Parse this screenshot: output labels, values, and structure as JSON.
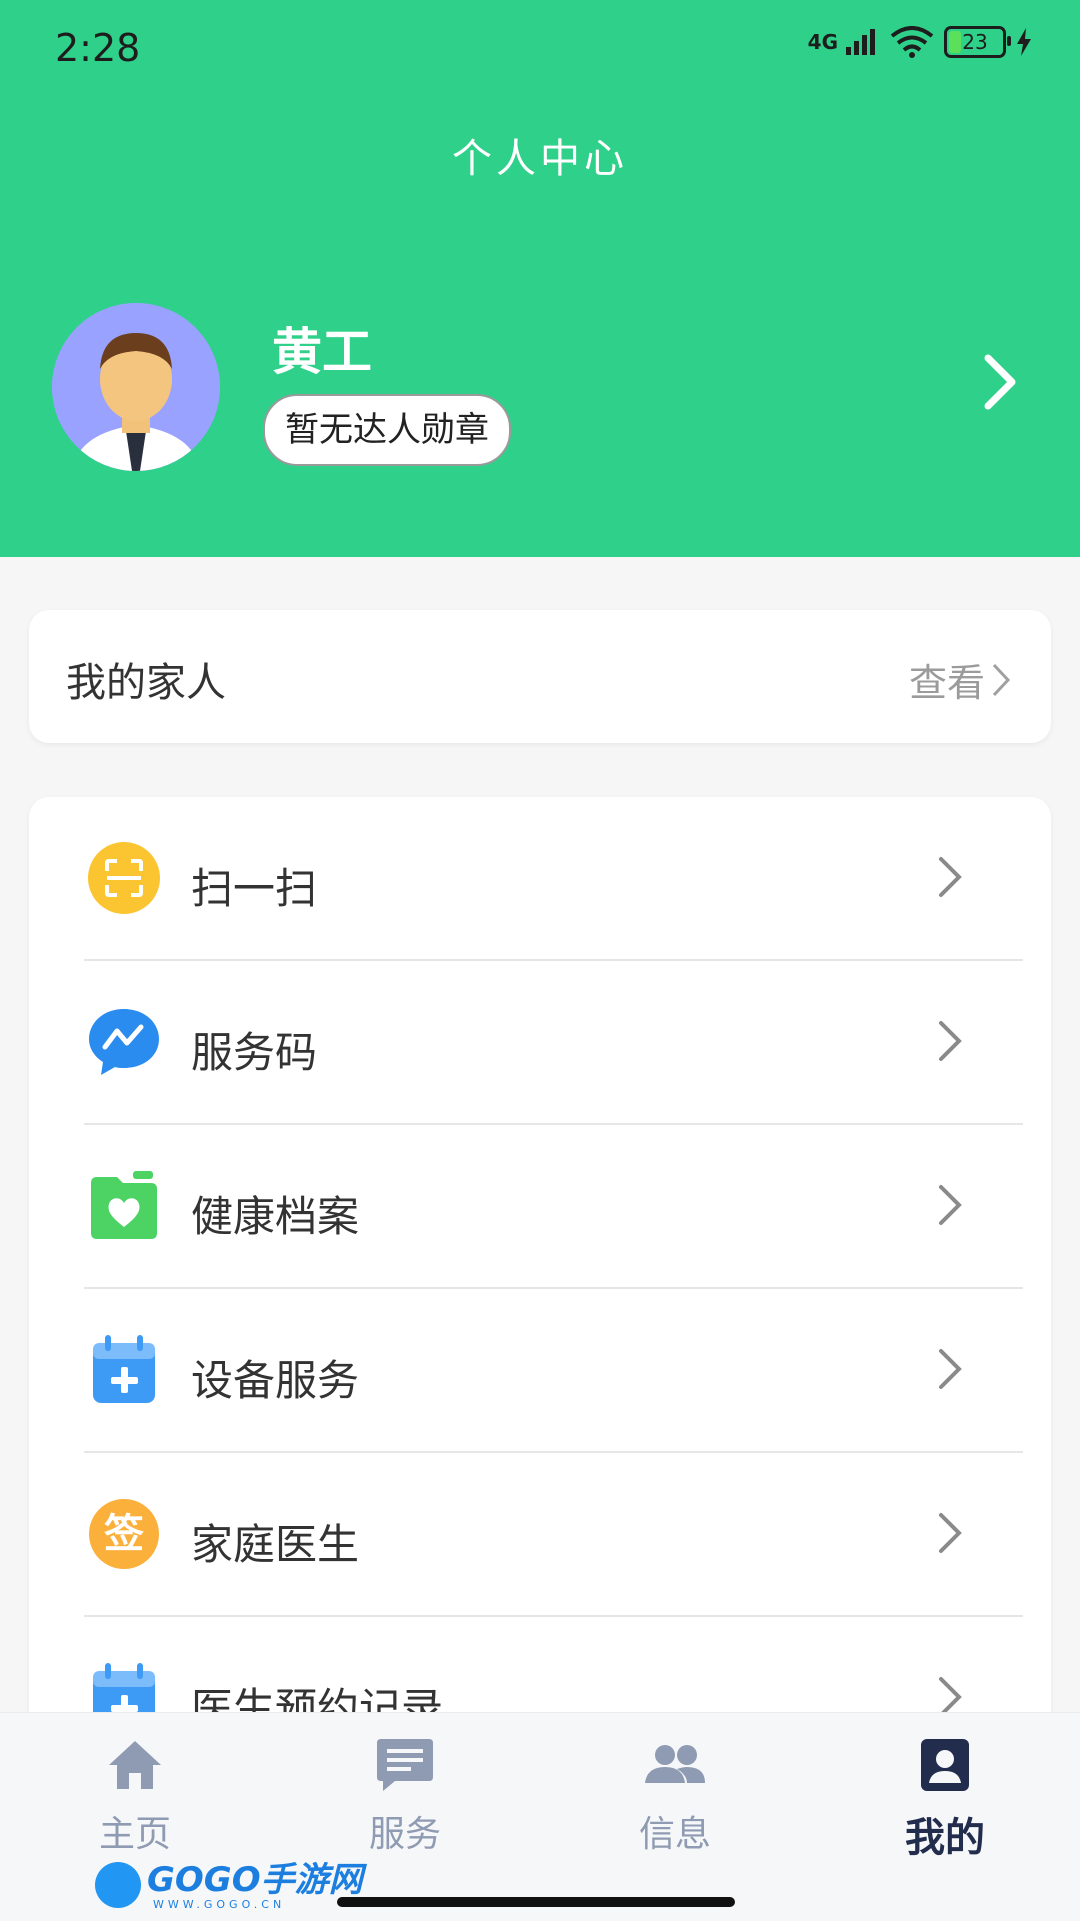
{
  "status_bar": {
    "time": "2:28",
    "network": "4G",
    "battery": "23"
  },
  "header": {
    "title": "个人中心"
  },
  "profile": {
    "name": "黄工",
    "badge": "暂无达人勋章"
  },
  "family_card": {
    "label": "我的家人",
    "action": "查看"
  },
  "menu": [
    {
      "label": "扫一扫",
      "icon": "scan-icon"
    },
    {
      "label": "服务码",
      "icon": "chat-bubble-icon"
    },
    {
      "label": "健康档案",
      "icon": "health-folder-icon"
    },
    {
      "label": "设备服务",
      "icon": "calendar-plus-icon"
    },
    {
      "label": "家庭医生",
      "icon": "sign-badge-icon",
      "icon_text": "签"
    },
    {
      "label": "医生预约记录",
      "icon": "calendar-plus-icon"
    }
  ],
  "tabs": [
    {
      "label": "主页",
      "icon": "home-icon",
      "active": false
    },
    {
      "label": "服务",
      "icon": "message-icon",
      "active": false
    },
    {
      "label": "信息",
      "icon": "people-icon",
      "active": false
    },
    {
      "label": "我的",
      "icon": "person-card-icon",
      "active": true
    }
  ],
  "watermark": {
    "main": "GOGO手游网",
    "sub": "WWW.GOGO.CN"
  },
  "colors": {
    "header_green": "#2fd089",
    "tab_active": "#222d4d",
    "tab_inactive": "#8f9bb2"
  }
}
